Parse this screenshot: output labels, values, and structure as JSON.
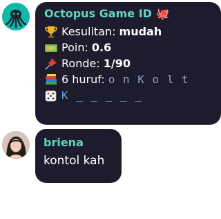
{
  "bot": {
    "avatar_icon": "octopus-avatar-icon",
    "name": "Octopus Game ID 🐙",
    "rows": [
      {
        "icon": "trophy-icon",
        "label": "Kesulitan:",
        "value": "mudah"
      },
      {
        "icon": "money-icon",
        "label": "Poin:",
        "value": "0.6"
      },
      {
        "icon": "pushpin-icon",
        "label": "Ronde:",
        "value": "1/90"
      },
      {
        "icon": "books-icon",
        "label": "6 huruf:",
        "value": "o n K o l t"
      },
      {
        "icon": "dice-icon",
        "label": "",
        "value": "K _ _ _ _ _"
      }
    ]
  },
  "user": {
    "avatar_icon": "user-avatar-icon",
    "name": "briena",
    "message": "kontol kah"
  },
  "colors": {
    "bubble_bg": "#1e1b2c",
    "name_color": "#5fd4c2",
    "avatar_bot_bg": "#0fb8a9"
  }
}
